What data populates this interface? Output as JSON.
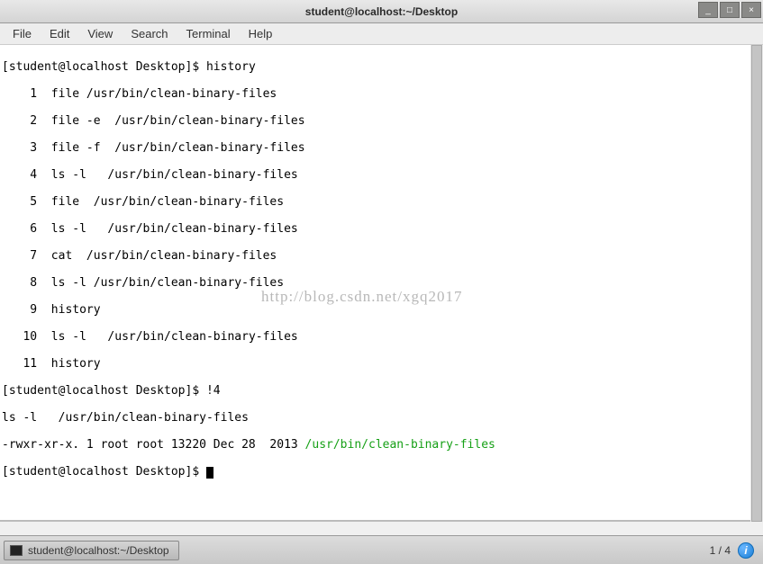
{
  "window": {
    "title": "student@localhost:~/Desktop"
  },
  "menu": {
    "file": "File",
    "edit": "Edit",
    "view": "View",
    "search": "Search",
    "terminal": "Terminal",
    "help": "Help"
  },
  "terminal": {
    "prompt1": "[student@localhost Desktop]$ ",
    "cmd1": "history",
    "history": [
      {
        "n": "    1  ",
        "c": "file /usr/bin/clean-binary-files"
      },
      {
        "n": "    2  ",
        "c": "file -e  /usr/bin/clean-binary-files"
      },
      {
        "n": "    3  ",
        "c": "file -f  /usr/bin/clean-binary-files"
      },
      {
        "n": "    4  ",
        "c": "ls -l   /usr/bin/clean-binary-files"
      },
      {
        "n": "    5  ",
        "c": "file  /usr/bin/clean-binary-files"
      },
      {
        "n": "    6  ",
        "c": "ls -l   /usr/bin/clean-binary-files"
      },
      {
        "n": "    7  ",
        "c": "cat  /usr/bin/clean-binary-files"
      },
      {
        "n": "    8  ",
        "c": "ls -l /usr/bin/clean-binary-files"
      },
      {
        "n": "    9  ",
        "c": "history"
      },
      {
        "n": "   10  ",
        "c": "ls -l   /usr/bin/clean-binary-files"
      },
      {
        "n": "   11  ",
        "c": "history"
      }
    ],
    "prompt2": "[student@localhost Desktop]$ ",
    "cmd2": "!4",
    "expanded": "ls -l   /usr/bin/clean-binary-files",
    "ls_prefix": "-rwxr-xr-x. 1 root root 13220 Dec 28  2013 ",
    "ls_path": "/usr/bin/clean-binary-files",
    "prompt3": "[student@localhost Desktop]$ "
  },
  "watermark": "http://blog.csdn.net/xgq2017",
  "taskbar": {
    "task_label": "student@localhost:~/Desktop",
    "page_indicator": "1 / 4"
  }
}
